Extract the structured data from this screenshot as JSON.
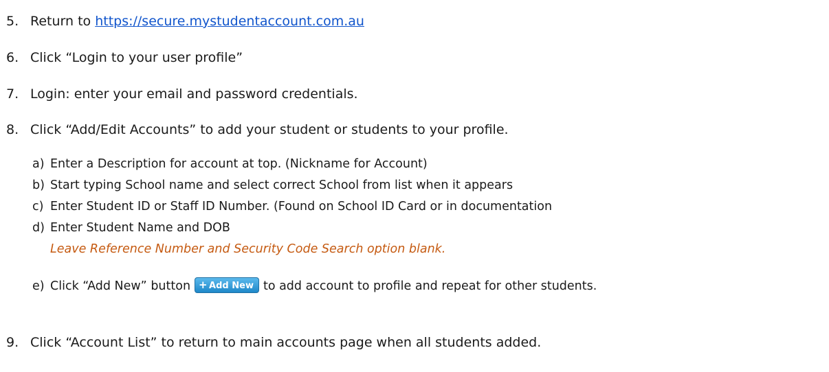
{
  "steps": [
    {
      "num": "5.",
      "prefix": "Return to ",
      "link": "https://secure.mystudentaccount.com.au"
    },
    {
      "num": "6.",
      "text": "Click “Login to your user profile”"
    },
    {
      "num": "7.",
      "text": "Login:  enter your email and password credentials."
    },
    {
      "num": "8.",
      "text": "Click “Add/Edit Accounts” to add your student or students to your profile."
    },
    {
      "num": "9.",
      "text": "Click “Account List” to return to main accounts page when all students added."
    }
  ],
  "substeps": [
    {
      "num": "a)",
      "text": "Enter a Description for account at top. (Nickname for Account)"
    },
    {
      "num": "b)",
      "text": "Start typing School name and select correct School from list when it appears"
    },
    {
      "num": "c)",
      "text": "Enter Student ID or Staff ID Number. (Found on School ID Card or in documentation"
    },
    {
      "num": "d)",
      "text": "Enter Student Name and DOB"
    },
    {
      "num": "e)",
      "text_before": "Click “Add New” button",
      "text_after": "to add account to profile and repeat for other students."
    }
  ],
  "note": "Leave Reference Number and Security Code Search option blank.",
  "add_button": {
    "icon": "plus-icon",
    "label": "Add New"
  },
  "colors": {
    "link": "#1155cc",
    "note": "#c55a11",
    "button": "#1e88c9"
  }
}
